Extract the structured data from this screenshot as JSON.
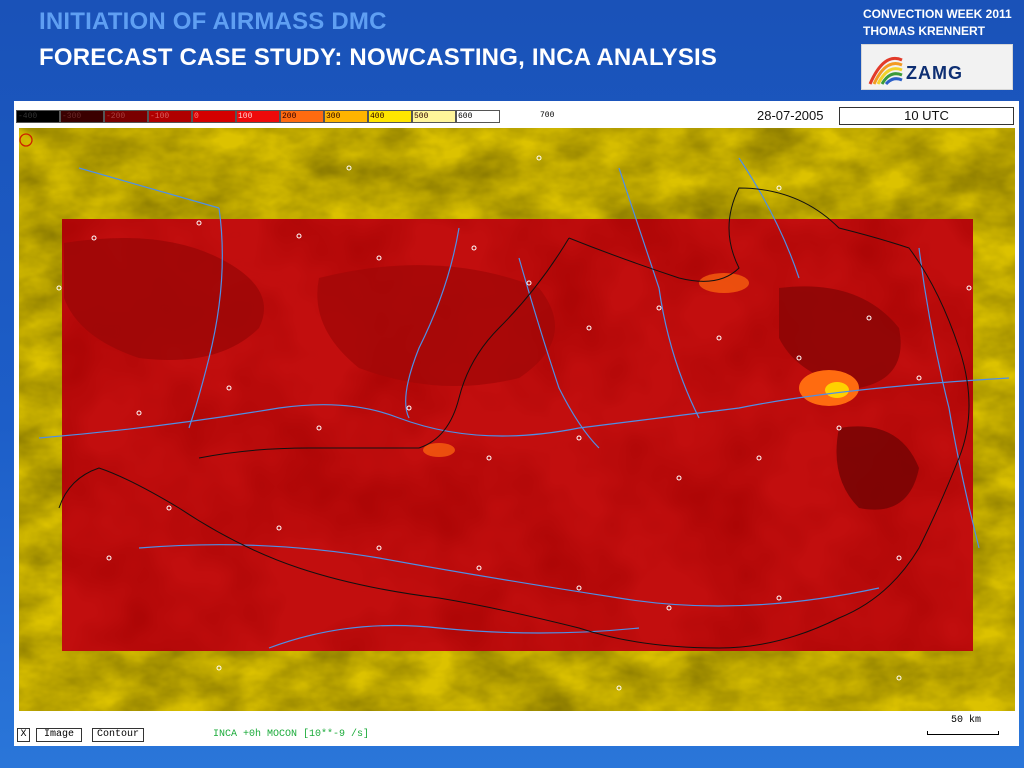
{
  "slide": {
    "title": "INITIATION OF AIRMASS DMC",
    "subtitle": "FORECAST CASE STUDY: NOWCASTING,  INCA ANALYSIS",
    "conference": "CONVECTION WEEK 2011",
    "author": "THOMAS KRENNERT",
    "logo_text": "ZAMG"
  },
  "viewer": {
    "legend": [
      {
        "label": "-400",
        "color": "#000000",
        "text_color": "#333333"
      },
      {
        "label": "-300",
        "color": "#3a0000",
        "text_color": "#6a2a2a"
      },
      {
        "label": "-200",
        "color": "#7a0000",
        "text_color": "#a84040"
      },
      {
        "label": "-100",
        "color": "#b00000",
        "text_color": "#d96060"
      },
      {
        "label": "0",
        "color": "#d40000",
        "text_color": "#ff8080"
      },
      {
        "label": "100",
        "color": "#ee0a0a",
        "text_color": "#ffd0d0"
      },
      {
        "label": "200",
        "color": "#ff6b10",
        "text_color": "#2a0000"
      },
      {
        "label": "300",
        "color": "#ffb400",
        "text_color": "#2a0000"
      },
      {
        "label": "400",
        "color": "#ffe600",
        "text_color": "#2a0000"
      },
      {
        "label": "500",
        "color": "#fff59a",
        "text_color": "#2a0000"
      },
      {
        "label": "600",
        "color": "#ffffff",
        "text_color": "#000000"
      }
    ],
    "legend_end": "700",
    "date": "28-07-2005",
    "time": "10 UTC",
    "buttons": {
      "close": "X",
      "image": "Image",
      "contour": "Contour"
    },
    "status": "INCA +0h MOCON [10**-9 /s]",
    "scale_label": "50 km"
  },
  "colors": {
    "outside_domain": "#dcc200",
    "field_base": "#c20e0e",
    "rivers": "#4f8fe6",
    "borders": "#111111"
  }
}
